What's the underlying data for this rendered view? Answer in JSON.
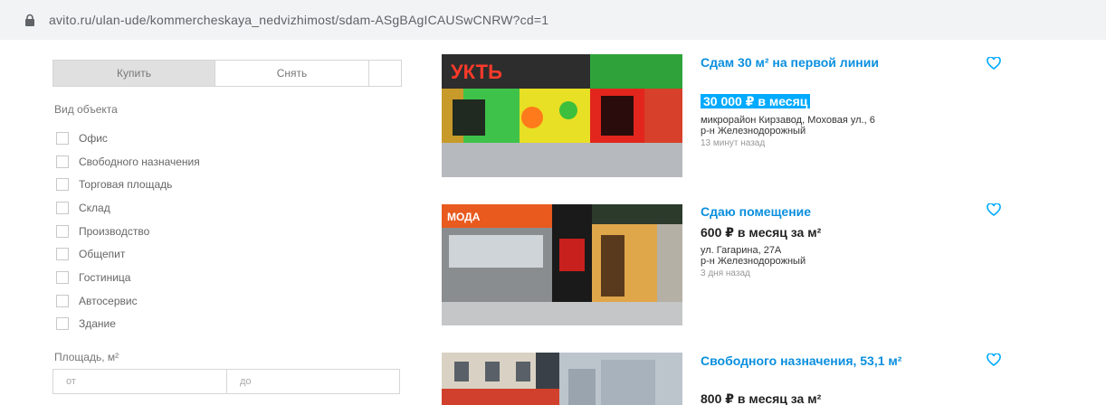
{
  "browser": {
    "url": "avito.ru/ulan-ude/kommercheskaya_nedvizhimost/sdam-ASgBAgICAUSwCNRW?cd=1"
  },
  "filters": {
    "deal_tabs": [
      "Купить",
      "Снять"
    ],
    "object_type_label": "Вид объекта",
    "object_types": [
      "Офис",
      "Свободного назначения",
      "Торговая площадь",
      "Склад",
      "Производство",
      "Общепит",
      "Гостиница",
      "Автосервис",
      "Здание"
    ],
    "area_label": "Площадь, м²",
    "area_from_placeholder": "от",
    "area_to_placeholder": "до"
  },
  "listings": [
    {
      "title": "Сдам 30 м² на первой линии",
      "price": "30 000 ₽ в месяц",
      "address": "микрорайон Кирзавод, Моховая ул., 6",
      "district": "р-н Железнодорожный",
      "time": "13 минут назад"
    },
    {
      "title": "Сдаю помещение",
      "price": "600 ₽ в месяц за м²",
      "address": "ул. Гагарина, 27А",
      "district": "р-н Железнодорожный",
      "time": "3 дня назад"
    },
    {
      "title": "Свободного назначения, 53,1 м²",
      "price": "800 ₽ в месяц за м²"
    }
  ],
  "colors": {
    "link": "#0a8fde",
    "price_highlight": "#00aaff",
    "heart": "#0af"
  }
}
